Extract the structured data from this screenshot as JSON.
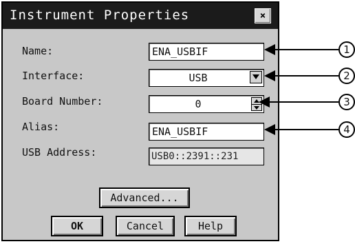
{
  "window": {
    "title": "Instrument Properties",
    "close_label": "×"
  },
  "fields": {
    "name": {
      "label": "Name:",
      "value": "ENA_USBIF"
    },
    "interface": {
      "label": "Interface:",
      "value": "USB"
    },
    "board_number": {
      "label": "Board Number:",
      "value": "0"
    },
    "alias": {
      "label": "Alias:",
      "value": "ENA_USBIF"
    },
    "usb_address": {
      "label": "USB Address:",
      "value": "USB0::2391::231"
    }
  },
  "buttons": {
    "advanced": "Advanced...",
    "ok": "OK",
    "cancel": "Cancel",
    "help": "Help"
  },
  "callouts": [
    "1",
    "2",
    "3",
    "4"
  ]
}
